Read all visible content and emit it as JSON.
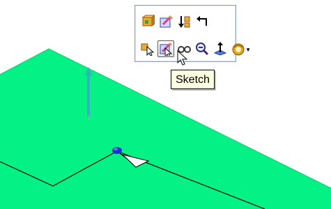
{
  "colors": {
    "face": "#04f185",
    "face_edge": "#22c070",
    "axis_arrow": "#2fb5b7",
    "point": "#1a33cc",
    "tooltip_bg": "#ffffe1"
  },
  "toolbar": {
    "row1": [
      {
        "icon": "part-properties-icon"
      },
      {
        "icon": "edit-feature-icon"
      },
      {
        "icon": "rollback-icon"
      },
      {
        "icon": "return-arrow-icon"
      }
    ],
    "row2": [
      {
        "icon": "select-other-icon"
      },
      {
        "icon": "sketch-icon",
        "pressed": true
      },
      {
        "icon": "hide-show-icon"
      },
      {
        "icon": "zoom-to-selection-icon"
      },
      {
        "icon": "normal-to-icon"
      },
      {
        "icon": "appearance-icon",
        "dropdown": true
      }
    ]
  },
  "tooltip": {
    "text": "Sketch"
  }
}
